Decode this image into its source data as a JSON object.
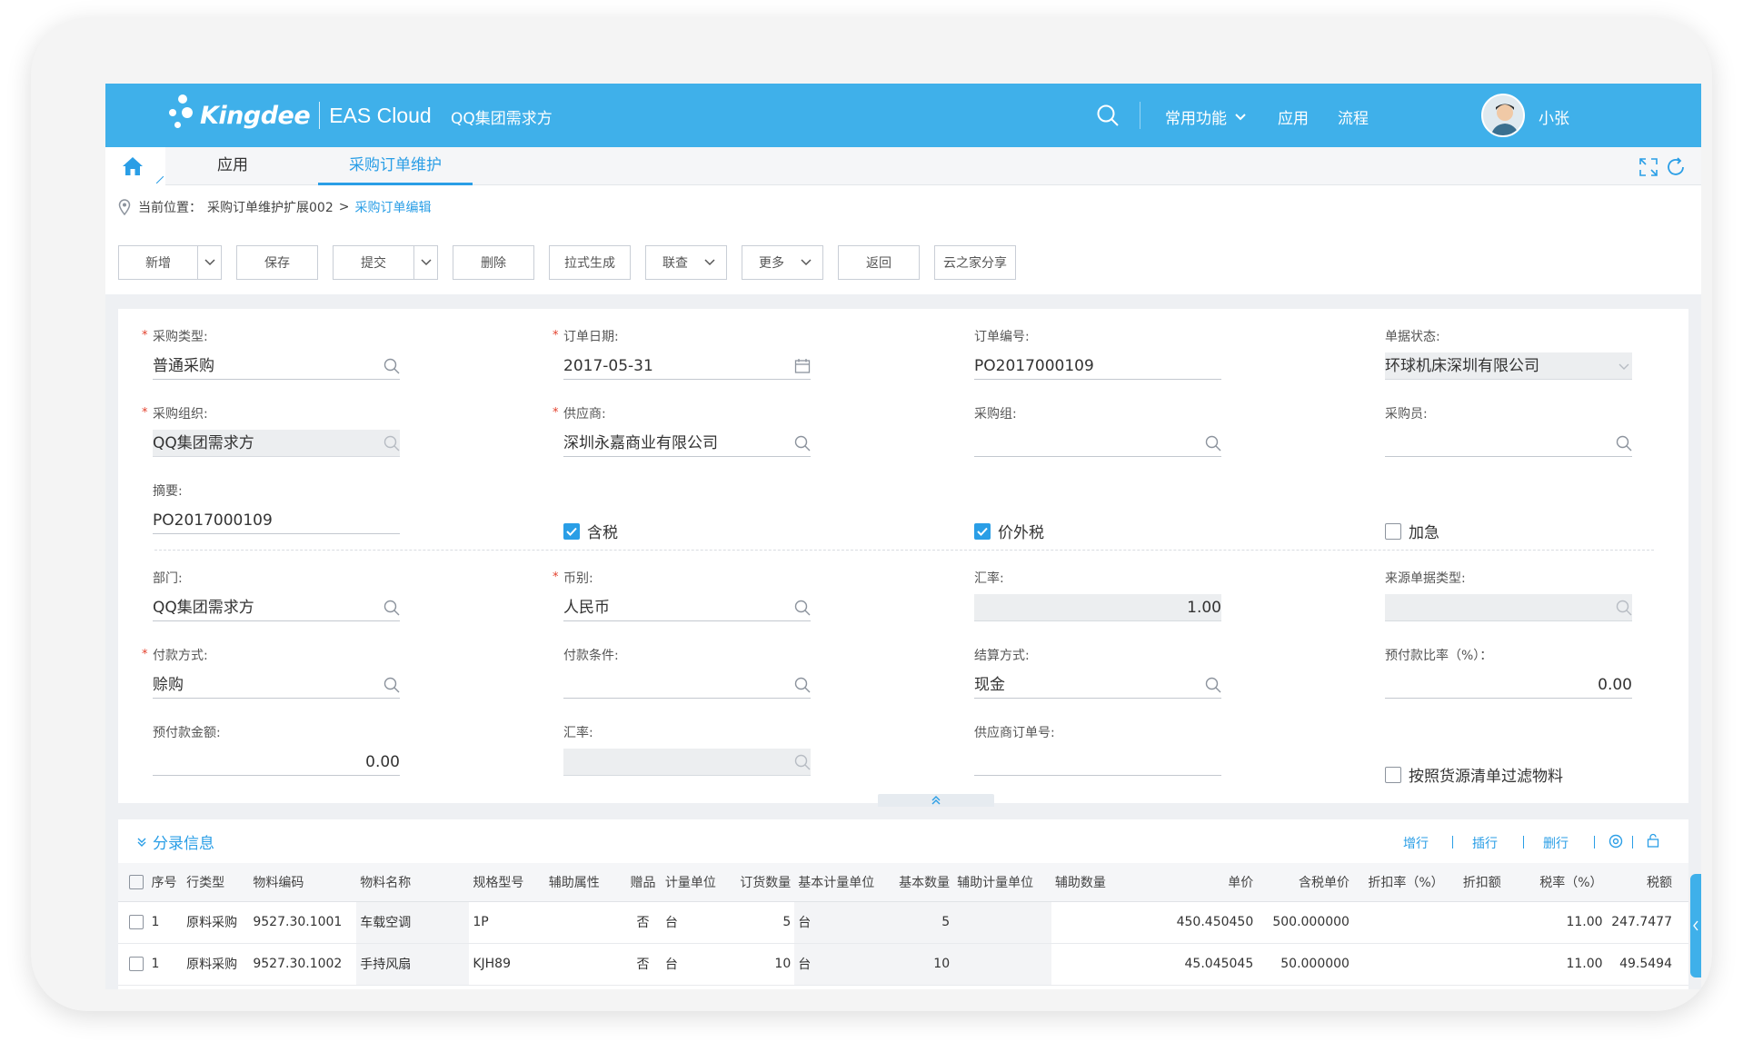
{
  "topbar": {
    "brand": "Kingdee",
    "product": "EAS Cloud",
    "tenant": "QQ集团需求方",
    "menus": [
      "常用功能",
      "应用",
      "流程"
    ],
    "user": "小张"
  },
  "tabs": [
    {
      "label": "应用",
      "active": false
    },
    {
      "label": "采购订单维护",
      "active": true
    }
  ],
  "breadcrumb": {
    "prefix": "当前位置：",
    "parent": "采购订单维护扩展002",
    "sep": ">",
    "current": "采购订单编辑"
  },
  "toolbar": {
    "new": "新增",
    "save": "保存",
    "submit": "提交",
    "delete": "删除",
    "pull": "拉式生成",
    "query": "联查",
    "more": "更多",
    "back": "返回",
    "share": "云之家分享"
  },
  "form": {
    "purchase_type": {
      "label": "采购类型:",
      "value": "普通采购",
      "required": true
    },
    "order_date": {
      "label": "订单日期:",
      "value": "2017-05-31",
      "required": true
    },
    "order_no": {
      "label": "订单编号:",
      "value": "PO2017000109"
    },
    "doc_status": {
      "label": "单据状态:",
      "value": "环球机床深圳有限公司"
    },
    "purchase_org": {
      "label": "采购组织:",
      "value": "QQ集团需求方",
      "required": true
    },
    "supplier": {
      "label": "供应商:",
      "value": "深圳永嘉商业有限公司",
      "required": true
    },
    "purchase_group": {
      "label": "采购组:",
      "value": ""
    },
    "buyer": {
      "label": "采购员:",
      "value": ""
    },
    "summary": {
      "label": "摘要:",
      "value": "PO2017000109"
    },
    "tax_included": {
      "label": "含税",
      "checked": true
    },
    "tax_exclusive": {
      "label": "价外税",
      "checked": true
    },
    "urgent": {
      "label": "加急",
      "checked": false
    },
    "department": {
      "label": "部门:",
      "value": "QQ集团需求方"
    },
    "currency": {
      "label": "币别:",
      "value": "人民币",
      "required": true
    },
    "exchange_rate": {
      "label": "汇率:",
      "value": "1.00"
    },
    "source_type": {
      "label": "来源单据类型:",
      "value": ""
    },
    "payment_method": {
      "label": "付款方式:",
      "value": "赊购",
      "required": true
    },
    "payment_terms": {
      "label": "付款条件:",
      "value": ""
    },
    "settlement": {
      "label": "结算方式:",
      "value": "现金"
    },
    "prepay_ratio": {
      "label": "预付款比率（%）：",
      "value": "0.00"
    },
    "prepay_amount": {
      "label": "预付款金额:",
      "value": "0.00"
    },
    "exchange_rate2": {
      "label": "汇率:",
      "value": ""
    },
    "supplier_order_no": {
      "label": "供应商订单号:",
      "value": ""
    },
    "filter_by_source": {
      "label": "按照货源清单过滤物料",
      "checked": false
    }
  },
  "entries": {
    "title": "分录信息",
    "actions": [
      "增行",
      "插行",
      "删行"
    ],
    "columns": [
      "序号",
      "行类型",
      "物料编码",
      "物料名称",
      "规格型号",
      "辅助属性",
      "赠品",
      "计量单位",
      "订货数量",
      "基本计量单位",
      "基本数量",
      "辅助计量单位",
      "辅助数量",
      "单价",
      "含税单价",
      "折扣率（%）",
      "折扣额",
      "税率（%）",
      "税额"
    ],
    "rows": [
      {
        "seq": "1",
        "line_type": "原料采购",
        "code": "9527.30.1001",
        "name": "车载空调",
        "spec": "1P",
        "aux": "",
        "gift": "否",
        "unit": "台",
        "qty": "5",
        "base_unit": "台",
        "base_qty": "5",
        "aux_unit": "",
        "aux_qty": "",
        "price": "450.450450",
        "tax_price": "500.000000",
        "discount_rate": "",
        "discount": "",
        "tax_rate": "11.00",
        "tax": "247.7477"
      },
      {
        "seq": "1",
        "line_type": "原料采购",
        "code": "9527.30.1002",
        "name": "手持风扇",
        "spec": "KJH89",
        "aux": "",
        "gift": "否",
        "unit": "台",
        "qty": "10",
        "base_unit": "台",
        "base_qty": "10",
        "aux_unit": "",
        "aux_qty": "",
        "price": "45.045045",
        "tax_price": "50.000000",
        "discount_rate": "",
        "discount": "",
        "tax_rate": "11.00",
        "tax": "49.5494"
      }
    ]
  },
  "colors": {
    "primary": "#3fb0ea",
    "link": "#2a9ee6",
    "required": "#e3402c"
  }
}
